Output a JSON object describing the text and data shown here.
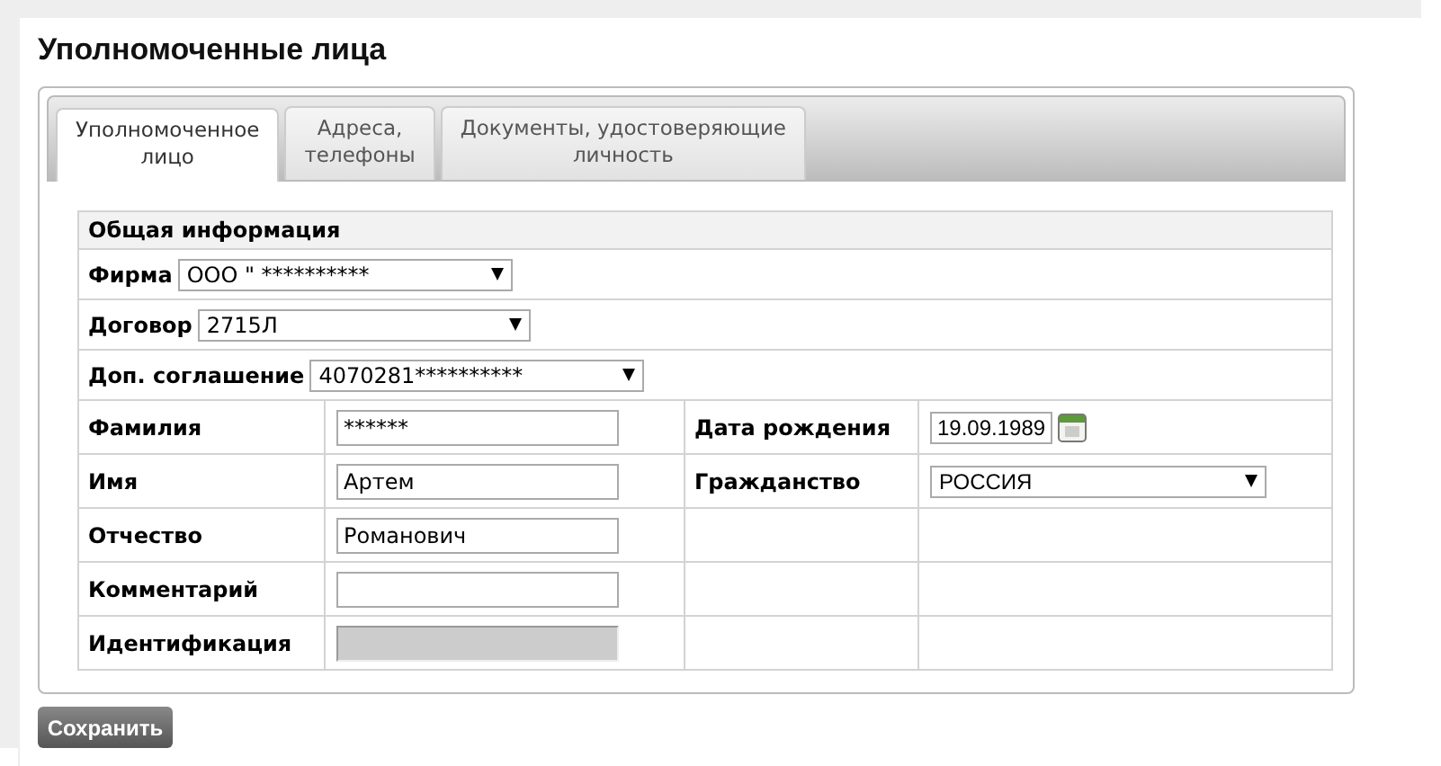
{
  "page_title": "Уполномоченные лица",
  "tabs": [
    {
      "label": "Уполномоченное\nлицо",
      "selected": true
    },
    {
      "label": "Адреса,\nтелефоны",
      "selected": false
    },
    {
      "label": "Документы, удостоверяющие\nличность",
      "selected": false
    }
  ],
  "section_title": "Общая информация",
  "select_rows": [
    {
      "label": "Фирма",
      "value": "ООО \"   **********"
    },
    {
      "label": "Договор",
      "value": "2715Л"
    },
    {
      "label": "Доп. соглашение",
      "value": "4070281**********"
    }
  ],
  "person_rows": [
    {
      "label": "Фамилия",
      "field": {
        "kind": "text",
        "value": "******"
      },
      "right": {
        "label": "Дата рождения",
        "field": {
          "kind": "date",
          "value": "19.09.1989"
        }
      }
    },
    {
      "label": "Имя",
      "field": {
        "kind": "text",
        "value": "Артем"
      },
      "right": {
        "label": "Гражданство",
        "field": {
          "kind": "select",
          "value": "РОССИЯ"
        }
      }
    },
    {
      "label": "Отчество",
      "field": {
        "kind": "text",
        "value": "Романович"
      }
    },
    {
      "label": "Комментарий",
      "field": {
        "kind": "text"
      }
    },
    {
      "label": "Идентификация",
      "field": {
        "kind": "disabled"
      }
    }
  ],
  "save_button": "Сохранить"
}
